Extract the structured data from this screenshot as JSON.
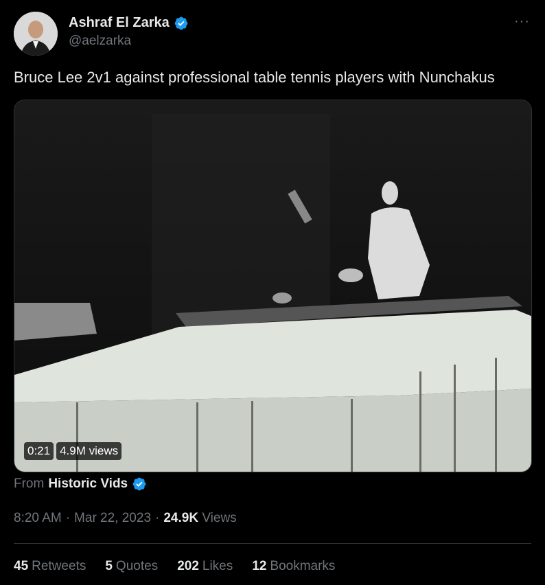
{
  "author": {
    "name": "Ashraf El Zarka",
    "handle": "@aelzarka"
  },
  "tweet": {
    "text": "Bruce Lee 2v1 against professional table tennis players with Nunchakus"
  },
  "media": {
    "duration": "0:21",
    "views": "4.9M views"
  },
  "source": {
    "label": "From",
    "name": "Historic Vids"
  },
  "meta": {
    "time": "8:20 AM",
    "date": "Mar 22, 2023",
    "views_count": "24.9K",
    "views_label": "Views"
  },
  "stats": [
    {
      "count": "45",
      "label": "Retweets"
    },
    {
      "count": "5",
      "label": "Quotes"
    },
    {
      "count": "202",
      "label": "Likes"
    },
    {
      "count": "12",
      "label": "Bookmarks"
    }
  ],
  "colors": {
    "background": "#000000",
    "verified": "#1d9bf0",
    "muted": "#71767b"
  },
  "icons": {
    "verified": "verified-badge-icon",
    "more": "more-options-icon"
  }
}
